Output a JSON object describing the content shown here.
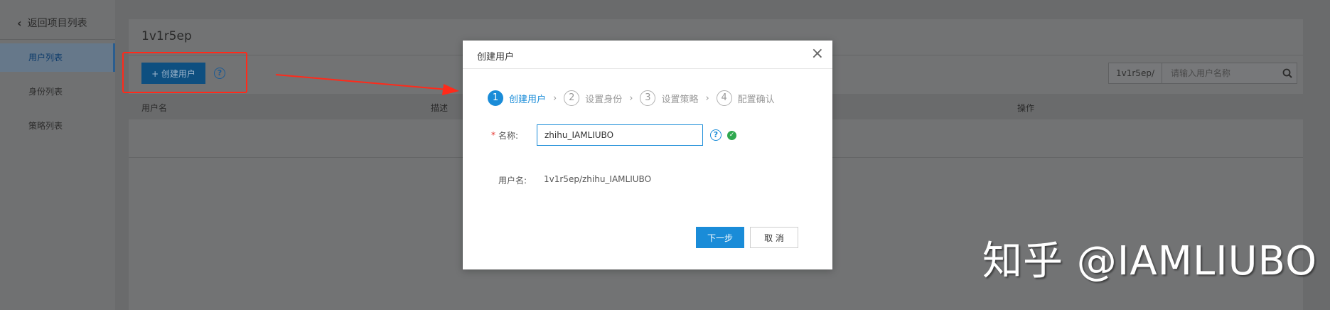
{
  "sidebar": {
    "back_label": "返回项目列表",
    "items": [
      {
        "label": "用户列表",
        "active": true
      },
      {
        "label": "身份列表",
        "active": false
      },
      {
        "label": "策略列表",
        "active": false
      }
    ]
  },
  "main": {
    "project_title": "1v1r5ep",
    "create_button": "+ 创建用户",
    "search": {
      "prefix": "1v1r5ep/",
      "placeholder": "请输入用户名称"
    },
    "table_headers": [
      "用户名",
      "描述",
      "操作"
    ]
  },
  "modal": {
    "title": "创建用户",
    "steps": [
      {
        "num": "1",
        "label": "创建用户",
        "active": true
      },
      {
        "num": "2",
        "label": "设置身份",
        "active": false
      },
      {
        "num": "3",
        "label": "设置策略",
        "active": false
      },
      {
        "num": "4",
        "label": "配置确认",
        "active": false
      }
    ],
    "name_label": "名称:",
    "name_value": "zhihu_IAMLIUBO",
    "username_label": "用户名:",
    "username_value": "1v1r5ep/zhihu_IAMLIUBO",
    "next_button": "下一步",
    "cancel_button": "取 消"
  },
  "watermark": "知乎 @IAMLIUBO",
  "colors": {
    "accent": "#1a8cd8",
    "annotation": "#ff2a1a",
    "success": "#2fa84f"
  }
}
